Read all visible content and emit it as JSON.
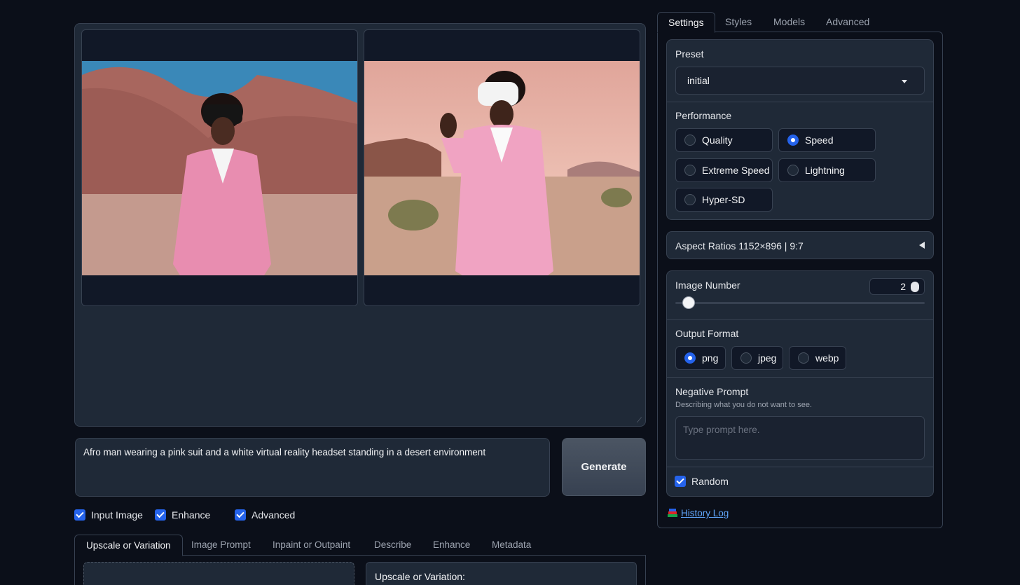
{
  "gallery": {
    "images": [
      {
        "alt": "Afro man in pink suit with black VR headset in pink desert"
      },
      {
        "alt": "Afro man in pink suit with white VR headset waving in desert"
      }
    ]
  },
  "prompt": {
    "text": "Afro man wearing a pink suit and a white virtual reality headset standing in a desert environment"
  },
  "generate_label": "Generate",
  "options": [
    {
      "label": "Input Image",
      "checked": true
    },
    {
      "label": "Enhance",
      "checked": true
    },
    {
      "label": "Advanced",
      "checked": true
    }
  ],
  "bottom_tabs": [
    "Upscale or Variation",
    "Image Prompt",
    "Inpaint or Outpaint",
    "Describe",
    "Enhance",
    "Metadata"
  ],
  "bottom_panel": {
    "upscale_title": "Upscale or Variation:"
  },
  "right_tabs": [
    "Settings",
    "Styles",
    "Models",
    "Advanced"
  ],
  "settings": {
    "preset_label": "Preset",
    "preset_value": "initial",
    "performance_label": "Performance",
    "performance_options": [
      "Quality",
      "Speed",
      "Extreme Speed",
      "Lightning",
      "Hyper-SD"
    ],
    "performance_selected": "Speed",
    "aspect_label": "Aspect Ratios 1152×896 | 9:7",
    "image_number_label": "Image Number",
    "image_number_value": "2",
    "image_number_level": 2,
    "output_format_label": "Output Format",
    "output_formats": [
      "png",
      "jpeg",
      "webp"
    ],
    "output_selected": "png",
    "negative_prompt_label": "Negative Prompt",
    "negative_prompt_hint": "Describing what you do not want to see.",
    "negative_prompt_placeholder": "Type prompt here.",
    "random_label": "Random",
    "random_checked": true
  },
  "history_log": "History Log",
  "colors": {
    "accent": "#2563eb",
    "background": "#0b0f19",
    "panel": "#1f2937",
    "link": "#60a5fa"
  }
}
